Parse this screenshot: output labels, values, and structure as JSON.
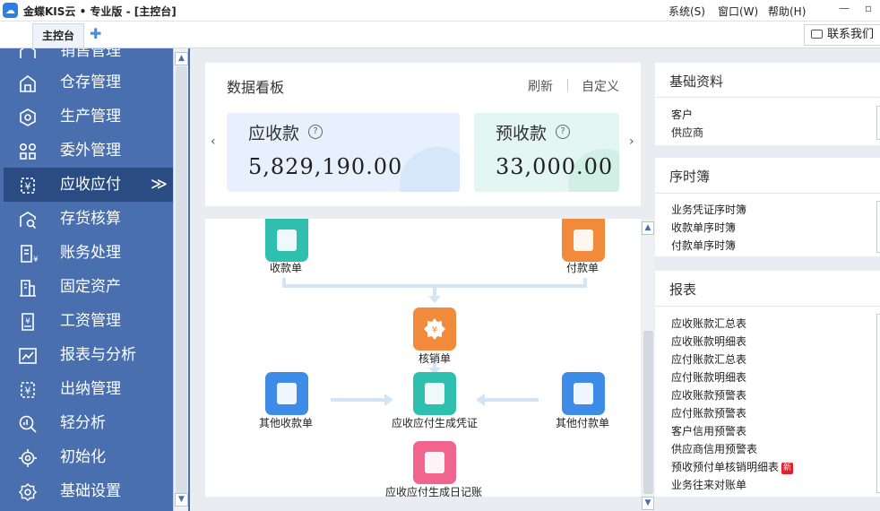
{
  "titlebar": {
    "app_logo": "☁",
    "title": "金蝶KIS云 • 专业版 - [主控台]",
    "menus": [
      "系统(S)",
      "窗口(W)",
      "帮助(H)"
    ],
    "min_glyph": "—",
    "restore_glyph": "▫"
  },
  "tabs": {
    "main_tab": "主控台",
    "add_glyph": "✚",
    "contact_label": "联系我们"
  },
  "sidebar": {
    "items": [
      {
        "label": "销售管理",
        "icon": "sales-icon"
      },
      {
        "label": "仓存管理",
        "icon": "warehouse-icon"
      },
      {
        "label": "生产管理",
        "icon": "production-icon"
      },
      {
        "label": "委外管理",
        "icon": "outsource-icon"
      },
      {
        "label": "应收应付",
        "icon": "receivable-icon",
        "active": true,
        "chevron": "≫"
      },
      {
        "label": "存货核算",
        "icon": "inventory-icon"
      },
      {
        "label": "账务处理",
        "icon": "accounting-icon"
      },
      {
        "label": "固定资产",
        "icon": "fixed-asset-icon"
      },
      {
        "label": "工资管理",
        "icon": "payroll-icon"
      },
      {
        "label": "报表与分析",
        "icon": "report-icon"
      },
      {
        "label": "出纳管理",
        "icon": "cashier-icon"
      },
      {
        "label": "轻分析",
        "icon": "analysis-icon"
      },
      {
        "label": "初始化",
        "icon": "init-icon"
      },
      {
        "label": "基础设置",
        "icon": "settings-icon"
      }
    ],
    "scroll_up": "▲",
    "scroll_down": "▼"
  },
  "dashboard": {
    "title": "数据看板",
    "refresh": "刷新",
    "customize": "自定义",
    "prev": "‹",
    "next": "›",
    "cards": [
      {
        "label": "应收款",
        "help": "?",
        "value": "5,829,190.00",
        "bg": "#e7f0fd"
      },
      {
        "label": "预收款",
        "help": "?",
        "value": "33,000.00",
        "bg": "#e3f6f1"
      }
    ]
  },
  "flow": {
    "nodes": [
      {
        "label": "收款单",
        "color": "#2fbfae"
      },
      {
        "label": "付款单",
        "color": "#f28a3b"
      },
      {
        "label": "核销单",
        "color": "#f28a3b"
      },
      {
        "label": "其他收款单",
        "color": "#3d8ce8"
      },
      {
        "label": "应收应付生成凭证",
        "color": "#2fbfae"
      },
      {
        "label": "其他付款单",
        "color": "#3d8ce8"
      },
      {
        "label": "应收应付生成日记账",
        "color": "#f0648e"
      }
    ],
    "scroll_up": "▲",
    "scroll_down": "▼"
  },
  "right": {
    "basic": {
      "title": "基础资料",
      "items": [
        "客户",
        "供应商"
      ]
    },
    "journal": {
      "title": "序时簿",
      "items": [
        "业务凭证序时簿",
        "收款单序时簿",
        "付款单序时簿"
      ]
    },
    "reports": {
      "title": "报表",
      "items": [
        "应收账款汇总表",
        "应收账款明细表",
        "应付账款汇总表",
        "应付账款明细表",
        "应收账款预警表",
        "应付账款预警表",
        "客户信用预警表",
        "供应商信用预警表",
        "预收预付单核销明细表",
        "业务往来对账单"
      ],
      "new_badge": "新"
    }
  }
}
